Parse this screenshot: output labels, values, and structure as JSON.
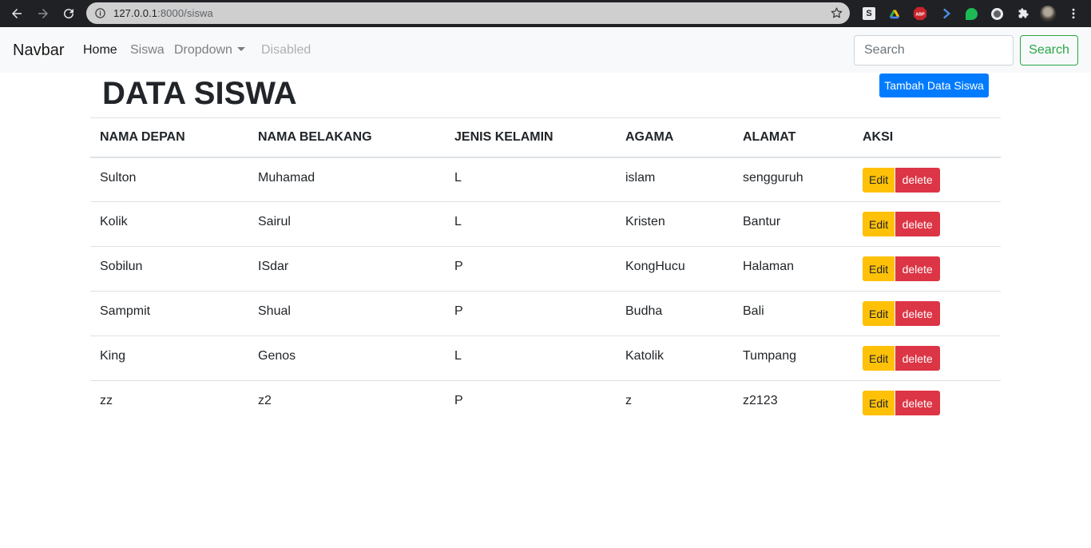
{
  "browser": {
    "url_host": "127.0.0.1",
    "url_rest": ":8000/siswa"
  },
  "navbar": {
    "brand": "Navbar",
    "links": [
      {
        "label": "Home"
      },
      {
        "label": "Siswa"
      },
      {
        "label": "Dropdown"
      },
      {
        "label": "Disabled"
      }
    ],
    "search_placeholder": "Search",
    "search_button": "Search"
  },
  "page": {
    "title": "DATA SISWA",
    "add_button": "Tambah Data Siswa"
  },
  "table": {
    "headers": [
      "NAMA DEPAN",
      "NAMA BELAKANG",
      "JENIS KELAMIN",
      "AGAMA",
      "ALAMAT",
      "AKSI"
    ],
    "rows": [
      [
        "Sulton",
        "Muhamad",
        "L",
        "islam",
        "sengguruh"
      ],
      [
        "Kolik",
        "Sairul",
        "L",
        "Kristen",
        "Bantur"
      ],
      [
        "Sobilun",
        "ISdar",
        "P",
        "KongHucu",
        "Halaman"
      ],
      [
        "Sampmit",
        "Shual",
        "P",
        "Budha",
        "Bali"
      ],
      [
        "King",
        "Genos",
        "L",
        "Katolik",
        "Tumpang"
      ],
      [
        "zz",
        "z2",
        "P",
        "z",
        "z2123"
      ]
    ],
    "edit_label": "Edit",
    "delete_label": "delete"
  },
  "colors": {
    "primary": "#007bff",
    "warning": "#ffc107",
    "danger": "#dc3545",
    "success": "#28a745"
  }
}
